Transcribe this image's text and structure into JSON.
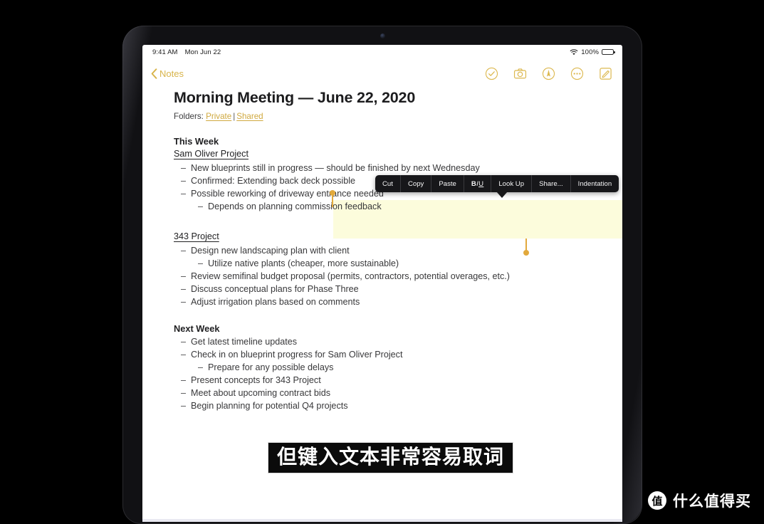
{
  "status_bar": {
    "time": "9:41 AM",
    "date": "Mon Jun 22",
    "wifi_icon": "wifi-icon",
    "battery_percent": "100%",
    "battery_icon": "battery-full-icon"
  },
  "nav": {
    "back_label": "Notes",
    "back_icon": "chevron-left-icon",
    "tools": [
      {
        "name": "checklist-icon",
        "glyph": "check-circle"
      },
      {
        "name": "camera-icon",
        "glyph": "camera"
      },
      {
        "name": "markup-pen-icon",
        "glyph": "pen-circle"
      },
      {
        "name": "more-options-icon",
        "glyph": "ellipsis-circle"
      },
      {
        "name": "compose-icon",
        "glyph": "compose-square"
      }
    ]
  },
  "note": {
    "title": "Morning Meeting — June 22, 2020",
    "folders_label": "Folders:",
    "folder_private": "Private",
    "folder_separator": "|",
    "folder_shared": "Shared",
    "sections": [
      {
        "heading": "This Week",
        "subheading": "Sam Oliver Project",
        "items": [
          {
            "level": 1,
            "text": "New blueprints still in progress — should be finished by next Wednesday",
            "selected": true
          },
          {
            "level": 1,
            "text": "Confirmed: Extending back deck possible",
            "selected": true
          },
          {
            "level": 1,
            "text": "Possible reworking of driveway entrance needed",
            "selected": true
          },
          {
            "level": 2,
            "text": "Depends on planning commission feedback",
            "selected": true
          }
        ]
      },
      {
        "heading": "",
        "subheading": "343 Project",
        "items": [
          {
            "level": 1,
            "text": "Design new landscaping plan with client",
            "selected": false
          },
          {
            "level": 2,
            "text": "Utilize native plants (cheaper, more sustainable)",
            "selected": false
          },
          {
            "level": 1,
            "text": "Review semifinal budget proposal (permits, contractors, potential overages, etc.)",
            "selected": false
          },
          {
            "level": 1,
            "text": "Discuss conceptual plans for Phase Three",
            "selected": false
          },
          {
            "level": 1,
            "text": "Adjust irrigation plans based on comments",
            "selected": false
          }
        ]
      },
      {
        "heading": "Next Week",
        "subheading": "",
        "items": [
          {
            "level": 1,
            "text": "Get latest timeline updates",
            "selected": false
          },
          {
            "level": 1,
            "text": "Check in on blueprint progress for Sam Oliver Project",
            "selected": false
          },
          {
            "level": 2,
            "text": "Prepare for any possible delays",
            "selected": false
          },
          {
            "level": 1,
            "text": "Present concepts for 343 Project",
            "selected": false
          },
          {
            "level": 1,
            "text": "Meet about upcoming contract bids",
            "selected": false
          },
          {
            "level": 1,
            "text": "Begin planning for potential Q4 projects",
            "selected": false
          }
        ]
      }
    ]
  },
  "context_menu": {
    "items": [
      "Cut",
      "Copy",
      "Paste",
      "B/U",
      "Look Up",
      "Share...",
      "Indentation"
    ],
    "cut": "Cut",
    "copy": "Copy",
    "paste": "Paste",
    "biu_b": "B",
    "biu_i": "I",
    "biu_u": "U",
    "look_up": "Look Up",
    "share": "Share...",
    "indentation": "Indentation"
  },
  "subtitle": "但键入文本非常容易取词",
  "watermark": {
    "logo_glyph": "值",
    "text": "什么值得买"
  },
  "colors": {
    "accent_gold": "#d8b44a",
    "selection_highlight": "#fcfcdc",
    "selection_handle": "#e2a93c",
    "menu_bg": "#17171a",
    "text_primary": "#2c2c2e"
  }
}
